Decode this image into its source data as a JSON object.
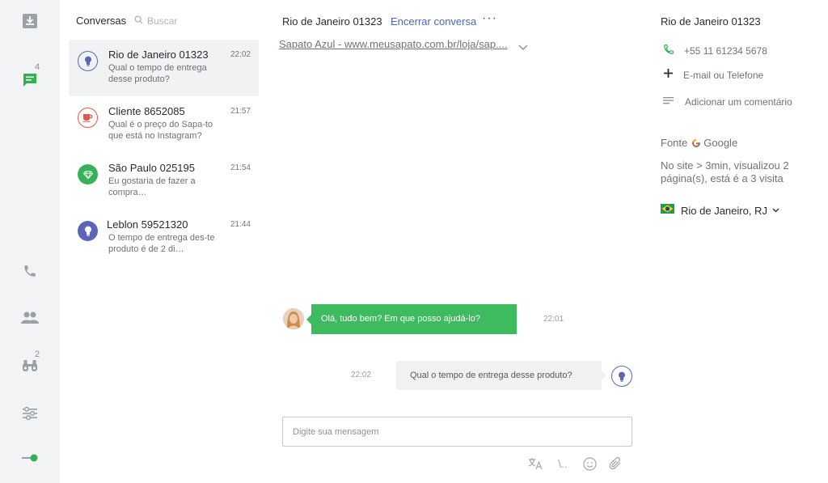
{
  "sidebar": {
    "chat_badge": "4",
    "contacts_badge": "2",
    "accent_color": "#2eb24d",
    "icons": [
      "inbox-icon",
      "chat-icon",
      "phone-icon",
      "people-icon",
      "binoculars-icon",
      "sliders-icon",
      "status-toggle-icon"
    ]
  },
  "list": {
    "title": "Conversas",
    "search_placeholder": "Buscar",
    "conversations": [
      {
        "name": "Rio de Janeiro 01323",
        "time": "22:02",
        "message": "Qual o tempo de entrega desse produto?",
        "icon": "lightbulb-icon",
        "color": "#5b66b8",
        "active": true
      },
      {
        "name": "Cliente 8652085",
        "time": "21:57",
        "message": "Qual é o preço do Sapa-to que está no Instagram?",
        "icon": "cup-icon",
        "color": "#e3584f",
        "active": false
      },
      {
        "name": "São Paulo 025195",
        "time": "21:54",
        "message": "Eu gostaria de fazer a compra…",
        "icon": "diamond-icon",
        "color": "#37b15a",
        "active": false
      },
      {
        "name": "Leblon 59521320",
        "time": "21:44",
        "message": "O tempo de entrega des-te produto é de 2 di…",
        "icon": "lightbulb-icon",
        "color": "#5b66b8",
        "active": false
      }
    ]
  },
  "chat": {
    "title": "Rio de Janeiro 01323",
    "end_label": "Encerrar conversa",
    "more_label": "···",
    "product_link": "Sapato Azul - www.meusapato.com.br/loja/sap....",
    "messages": [
      {
        "from": "agent",
        "text": "Olá, tudo bem? Em que posso ajudá-lo?",
        "time": "22:01"
      },
      {
        "from": "user",
        "text": "Qual o tempo de entrega desse produto?",
        "time": "22:02"
      }
    ],
    "input_placeholder": "Digite sua mensagem",
    "tools": [
      "translate-icon",
      "shortcut-icon",
      "emoji-icon",
      "attach-icon"
    ],
    "shortcut_text": "\\.."
  },
  "details": {
    "title": "Rio de Janeiro 01323",
    "phone": "+55 11 61234 5678",
    "add_contact": "E-mail ou Telefone",
    "add_comment": "Adicionar um comentário",
    "source_label": "Fonte",
    "source_name": "Google",
    "visit_info": "No site > 3min, visualizou 2 página(s), está é a 3 visita",
    "location": "Rio de Janeiro, RJ"
  }
}
